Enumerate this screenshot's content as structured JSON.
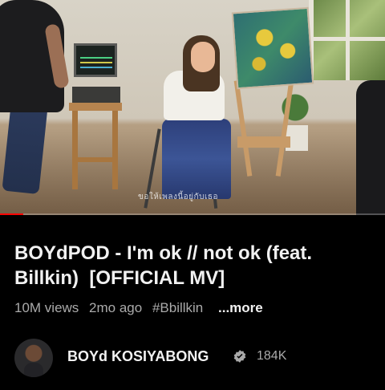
{
  "video": {
    "subtitle_overlay": "ขอให้เพลงนี้อยู่กับเธอ",
    "progress_fraction": 0.06
  },
  "info": {
    "title": "BOYdPOD - I'm ok // not ok (feat. Billkin)  [OFFICIAL MV]",
    "views": "10M views",
    "age": "2mo ago",
    "hashtag": "#Bbillkin",
    "more_label": "...more"
  },
  "channel": {
    "name": "BOYd KOSIYABONG",
    "verified_icon": "verified-badge-icon",
    "subscribers": "184K"
  },
  "colors": {
    "background": "#000000",
    "progress": "#ff0000",
    "secondary_text": "#aaaaaa"
  }
}
